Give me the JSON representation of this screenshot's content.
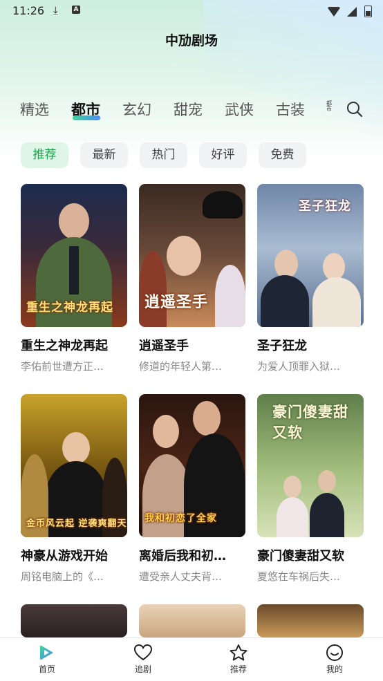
{
  "status": {
    "time": "11:26"
  },
  "app": {
    "title": "中劢剧场"
  },
  "tabs": [
    "精选",
    "都市",
    "玄幻",
    "甜宠",
    "武侠",
    "古装"
  ],
  "tab_more": "都市",
  "chips": [
    "推荐",
    "最新",
    "热门",
    "好评",
    "免费"
  ],
  "cards": [
    {
      "title": "重生之神龙再起",
      "desc": "李佑前世遭方正…",
      "poster_text": "重生之神龙再起"
    },
    {
      "title": "逍遥圣手",
      "desc": "修道的年轻人第…",
      "poster_text": "逍遥圣手"
    },
    {
      "title": "圣子狂龙",
      "desc": "为爱人顶罪入狱…",
      "poster_text": "圣子狂龙"
    },
    {
      "title": "神豪从游戏开始",
      "desc": "周铭电脑上的《…",
      "poster_text": "金币风云起 逆袭爽翻天"
    },
    {
      "title": "离婚后我和初…",
      "desc": "遭受亲人丈夫背…",
      "poster_text": "我和初恋了全家"
    },
    {
      "title": "豪门傻妻甜又软",
      "desc": "夏悠在车祸后失…",
      "poster_text": "豪门傻妻甜又软"
    }
  ],
  "nav": [
    {
      "label": "首页"
    },
    {
      "label": "追剧"
    },
    {
      "label": "推荐"
    },
    {
      "label": "我的"
    }
  ],
  "colors": {
    "accent": "#17a34a",
    "accent_gradient_start": "#3fd49b",
    "accent_gradient_end": "#4a8cf5"
  }
}
